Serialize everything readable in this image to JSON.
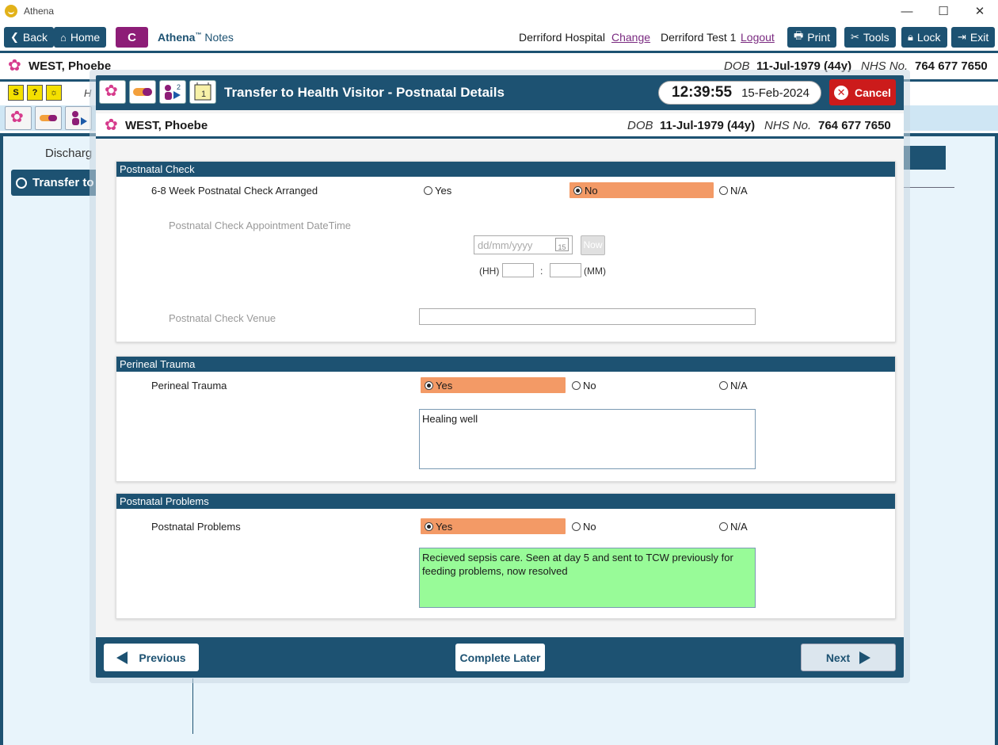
{
  "window": {
    "title": "Athena",
    "minimize": "—",
    "maximize": "☐",
    "close": "✕"
  },
  "nav": {
    "back": "Back",
    "home": "Home",
    "c_label": "C",
    "app_name": "Athena",
    "app_tm": "™",
    "app_section": "Notes",
    "hospital": "Derriford Hospital",
    "change": "Change",
    "user": "Derriford Test 1",
    "logout": "Logout",
    "print": "Print",
    "tools": "Tools",
    "lock": "Lock",
    "exit": "Exit"
  },
  "patient": {
    "name": "WEST, Phoebe",
    "dob_label": "DOB",
    "dob": "11-Jul-1979 (44y)",
    "nhs_label": "NHS No.",
    "nhs": "764 677 7650"
  },
  "background": {
    "header_partial": "H",
    "discharge_partial": "Discharg",
    "transfer_partial": "Transfer to"
  },
  "modal": {
    "title": "Transfer to Health Visitor - Postnatal Details",
    "time": "12:39:55",
    "date": "15-Feb-2024",
    "cancel": "Cancel",
    "icon_badges": {
      "count_two": "2",
      "count_one": "1"
    }
  },
  "sections": {
    "postnatal_check": {
      "title": "Postnatal Check",
      "question": "6-8 Week Postnatal Check Arranged",
      "options": [
        "Yes",
        "No",
        "N/A"
      ],
      "selected": "No",
      "appt_label": "Postnatal Check Appointment DateTime",
      "date_placeholder": "dd/mm/yyyy",
      "calendar_day": "15",
      "now_label": "Now",
      "hh_label": "(HH)",
      "colon": ":",
      "mm_label": "(MM)",
      "venue_label": "Postnatal Check Venue",
      "venue_value": ""
    },
    "perineal_trauma": {
      "title": "Perineal Trauma",
      "question": "Perineal Trauma",
      "options": [
        "Yes",
        "No",
        "N/A"
      ],
      "selected": "Yes",
      "notes": "Healing well"
    },
    "postnatal_problems": {
      "title": "Postnatal Problems",
      "question": "Postnatal Problems",
      "options": [
        "Yes",
        "No",
        "N/A"
      ],
      "selected": "Yes",
      "notes": "Recieved sepsis care. Seen at day 5 and sent to TCW previously for feeding problems, now resolved"
    }
  },
  "footer": {
    "previous": "Previous",
    "complete_later": "Complete Later",
    "next": "Next"
  },
  "colors": {
    "primary": "#1d5272",
    "selected_option": "#f39a66",
    "cancel": "#cc1b1b",
    "notes_highlight": "#98fb98"
  }
}
